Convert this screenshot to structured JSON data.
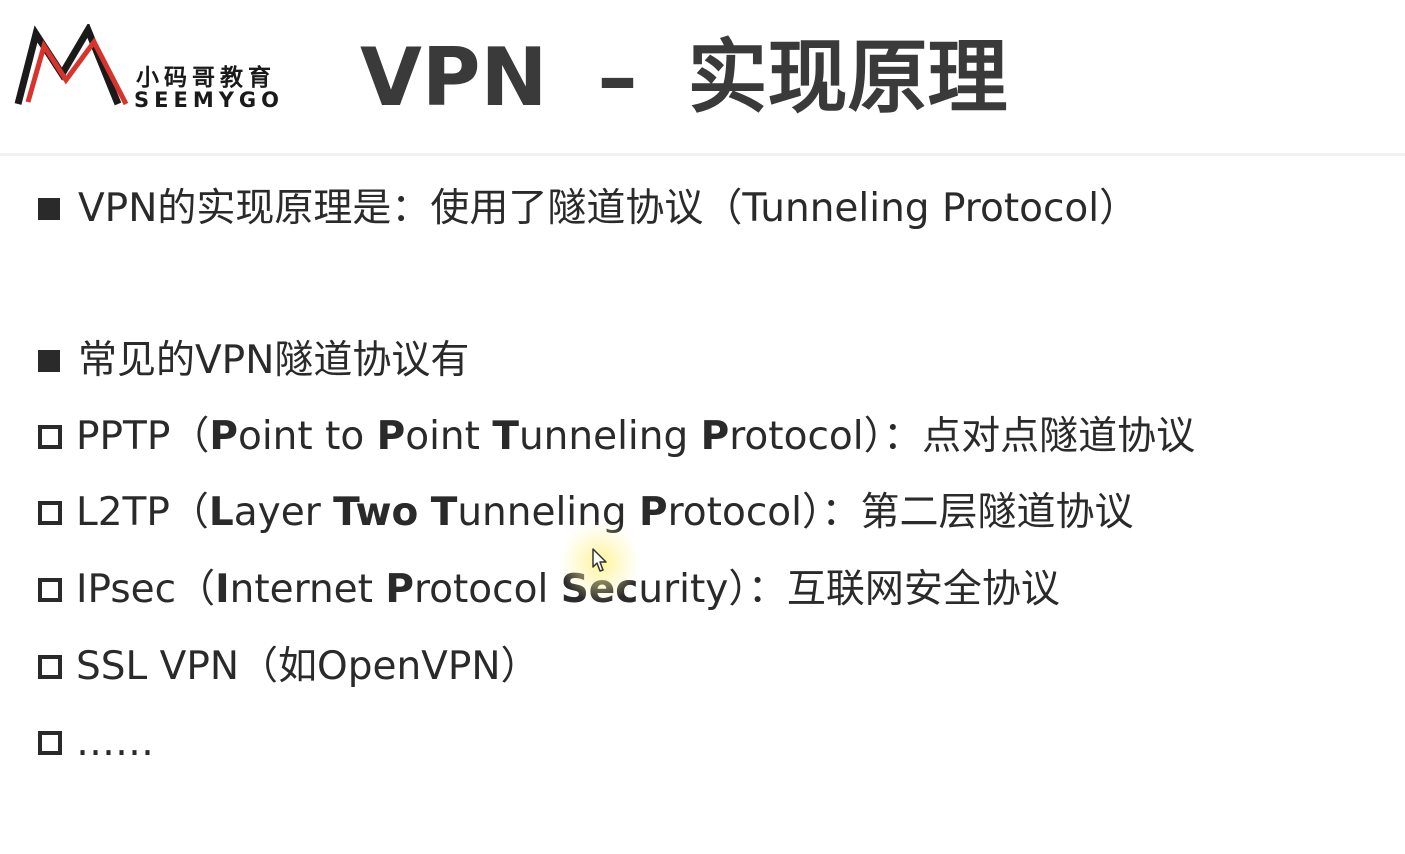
{
  "logo": {
    "cn": "小码哥教育",
    "en": "SEEMYGO"
  },
  "title": {
    "main": "VPN",
    "sep": "–",
    "sub": "实现原理"
  },
  "lines": {
    "l1": "VPN的实现原理是：使用了隧道协议（Tunneling Protocol）",
    "l2": "常见的VPN隧道协议有",
    "pptp": {
      "prefix": "PPTP（",
      "b1": "P",
      "t1": "oint to ",
      "b2": "P",
      "t2": "oint ",
      "b3": "T",
      "t3": "unneling ",
      "b4": "P",
      "t4": "rotocol）：点对点隧道协议"
    },
    "l2tp": {
      "prefix": "L2TP（",
      "b1": "L",
      "t1": "ayer ",
      "b2": "Two",
      "t2": " ",
      "b3": "T",
      "t3": "unneling ",
      "b4": "P",
      "t4": "rotocol）：第二层隧道协议"
    },
    "ipsec": {
      "prefix": "IPsec（",
      "b1": "I",
      "t1": "nternet ",
      "b2": "P",
      "t2": "rotocol ",
      "b3": "Sec",
      "t3": "urity）：互联网安全协议"
    },
    "ssl": "SSL VPN（如OpenVPN）",
    "more": "……"
  },
  "colors": {
    "logo_red": "#d8342c",
    "logo_black": "#1a1a1a",
    "text": "#2a2a2a"
  }
}
